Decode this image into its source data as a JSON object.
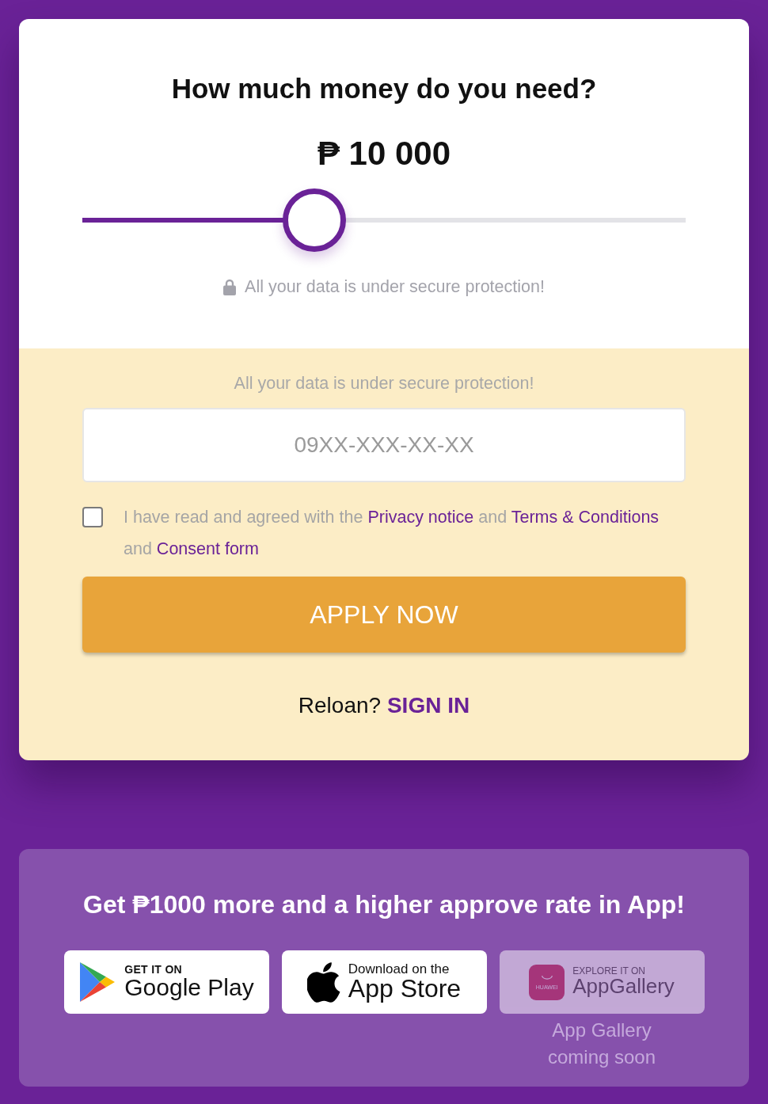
{
  "loan_calculator": {
    "title": "How much money do you need?",
    "amount": "₱ 10 000",
    "slider": {
      "level": 0.385
    },
    "security_note": "All your data is under secure protection!"
  },
  "application_form": {
    "security_note": "All your data is under secure protection!",
    "phone_field": {
      "placeholder": "09XX-XXX-XX-XX"
    },
    "consent": {
      "checked": false,
      "parts": [
        {
          "kind": "text",
          "text": "I have read and agreed with the"
        },
        {
          "kind": "link",
          "text": "Privacy notice"
        },
        {
          "kind": "text",
          "text": "and"
        },
        {
          "kind": "link",
          "text": "Terms & Conditions"
        },
        {
          "kind": "text",
          "text": "and"
        },
        {
          "kind": "link",
          "text": "Consent form"
        }
      ]
    },
    "apply_button": "APPLY NOW",
    "reloan": {
      "prompt": "Reloan?",
      "link": "SIGN IN"
    }
  },
  "app_promo": {
    "title": "Get ₱1000 more and a higher approve rate in App!",
    "stores": [
      {
        "kind": "google",
        "caption": "GET IT ON",
        "name": "Google Play",
        "disabled": false
      },
      {
        "kind": "apple",
        "caption": "Download on the",
        "name": "App Store",
        "disabled": false
      },
      {
        "kind": "huawei",
        "logo_text": "HUAWEI",
        "caption": "EXPLORE IT ON",
        "name": "AppGallery",
        "disabled": true,
        "note": "App Gallery coming soon"
      }
    ]
  }
}
